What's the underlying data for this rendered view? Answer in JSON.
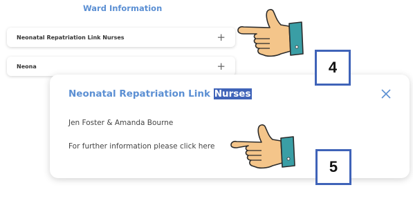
{
  "section": {
    "title": "Ward Information"
  },
  "rows": [
    {
      "label": "Neonatal Repatriation Link Nurses",
      "icon": "plus-icon"
    },
    {
      "label": "Neona",
      "icon": "plus-icon"
    }
  ],
  "popup": {
    "title_main": "Neonatal Repatriation Link ",
    "title_highlight": "Nurses",
    "names": "Jen Foster & Amanda Bourne",
    "info": "For further information please click here",
    "close_icon": "close-icon"
  },
  "annotations": {
    "step4": "4",
    "step5": "5"
  },
  "colors": {
    "accent": "#5b8fd3",
    "highlight": "#3f63b8",
    "hand_skin": "#f4c58a",
    "cuff": "#3a9ea5"
  }
}
